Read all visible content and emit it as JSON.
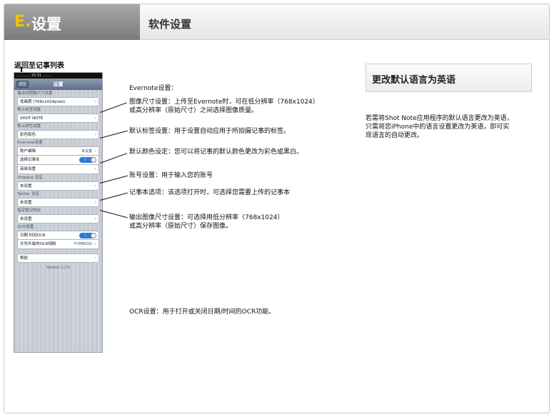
{
  "header": {
    "letter": "E.",
    "chapter": "设置",
    "title": "软件设置"
  },
  "back_label": "返回至记事列表",
  "phone": {
    "status_text": "............   15:31   ........",
    "nav_back": "返回",
    "nav_title": "设置",
    "sections": [
      {
        "header": "输出的图像尺寸设置",
        "rows": [
          {
            "label": "低画质 (768x1024pixel)",
            "value": "",
            "chevron": true
          }
        ]
      },
      {
        "header": "默认标签设置",
        "rows": [
          {
            "label": "SHOT NOTE",
            "value": "",
            "chevron": true
          }
        ]
      },
      {
        "header": "默认颜色设置",
        "rows": [
          {
            "label": "彩色取色",
            "value": "",
            "chevron": true
          }
        ]
      },
      {
        "header": "Evernote设置",
        "rows": [
          {
            "label": "账户编辑",
            "value": "未设置",
            "chevron": true
          },
          {
            "label": "选择记事本",
            "value": "",
            "toggle": "I"
          },
          {
            "label": "高级设置",
            "value": "",
            "chevron": true
          }
        ]
      },
      {
        "header": "Dropbox 设定",
        "rows": [
          {
            "label": "未设置",
            "value": "",
            "chevron": true
          }
        ]
      },
      {
        "header": "Twitter 设定",
        "rows": [
          {
            "label": "未设置",
            "value": "",
            "chevron": true
          }
        ]
      },
      {
        "header": "指定笔记地址",
        "rows": [
          {
            "label": "未设置",
            "value": "",
            "chevron": true
          }
        ]
      },
      {
        "header": "OCR设置",
        "rows": [
          {
            "label": "日期·时间OCR",
            "value": "",
            "toggle": "I"
          },
          {
            "label": "文先升级的OCR规制",
            "value": "YY/MM/DD",
            "chevron": true
          }
        ]
      },
      {
        "header": "",
        "rows": [
          {
            "label": "帮助",
            "value": "",
            "chevron": true
          }
        ]
      }
    ],
    "version": "Version 1.2.0"
  },
  "notes": {
    "evernote": "Evernote设置：",
    "image_size": "图像尺寸设置：上传至Evernote时，可在低分辨率（768x1024）\n或高分辨率（原始尺寸）之间选择图像质量。",
    "default_tag": "默认标签设置：用于设置自动应用于所拍摄记事的标签。",
    "default_color": "默认颜色设定：您可以将记事的默认颜色更改为彩色或黑白。",
    "account": "账号设置：用于输入您的账号",
    "notebook": "记事本选项：该选项打开时，可选择您需要上传的记事本",
    "output_size": "输出图像尺寸设置：可选择用低分辨率（768x1024）\n或高分辨率（原始尺寸）保存图像。",
    "ocr": "OCR设置：用于打开或关闭日期/时间的OCR功能。"
  },
  "language": {
    "box_title": "更改默认语言为英语",
    "description": "若需将Shot Note应用程序的默认语言更改为英语，\n只需将您iPhone中的语言设置更改为英语，即可实\n现语言的自动更改。"
  }
}
